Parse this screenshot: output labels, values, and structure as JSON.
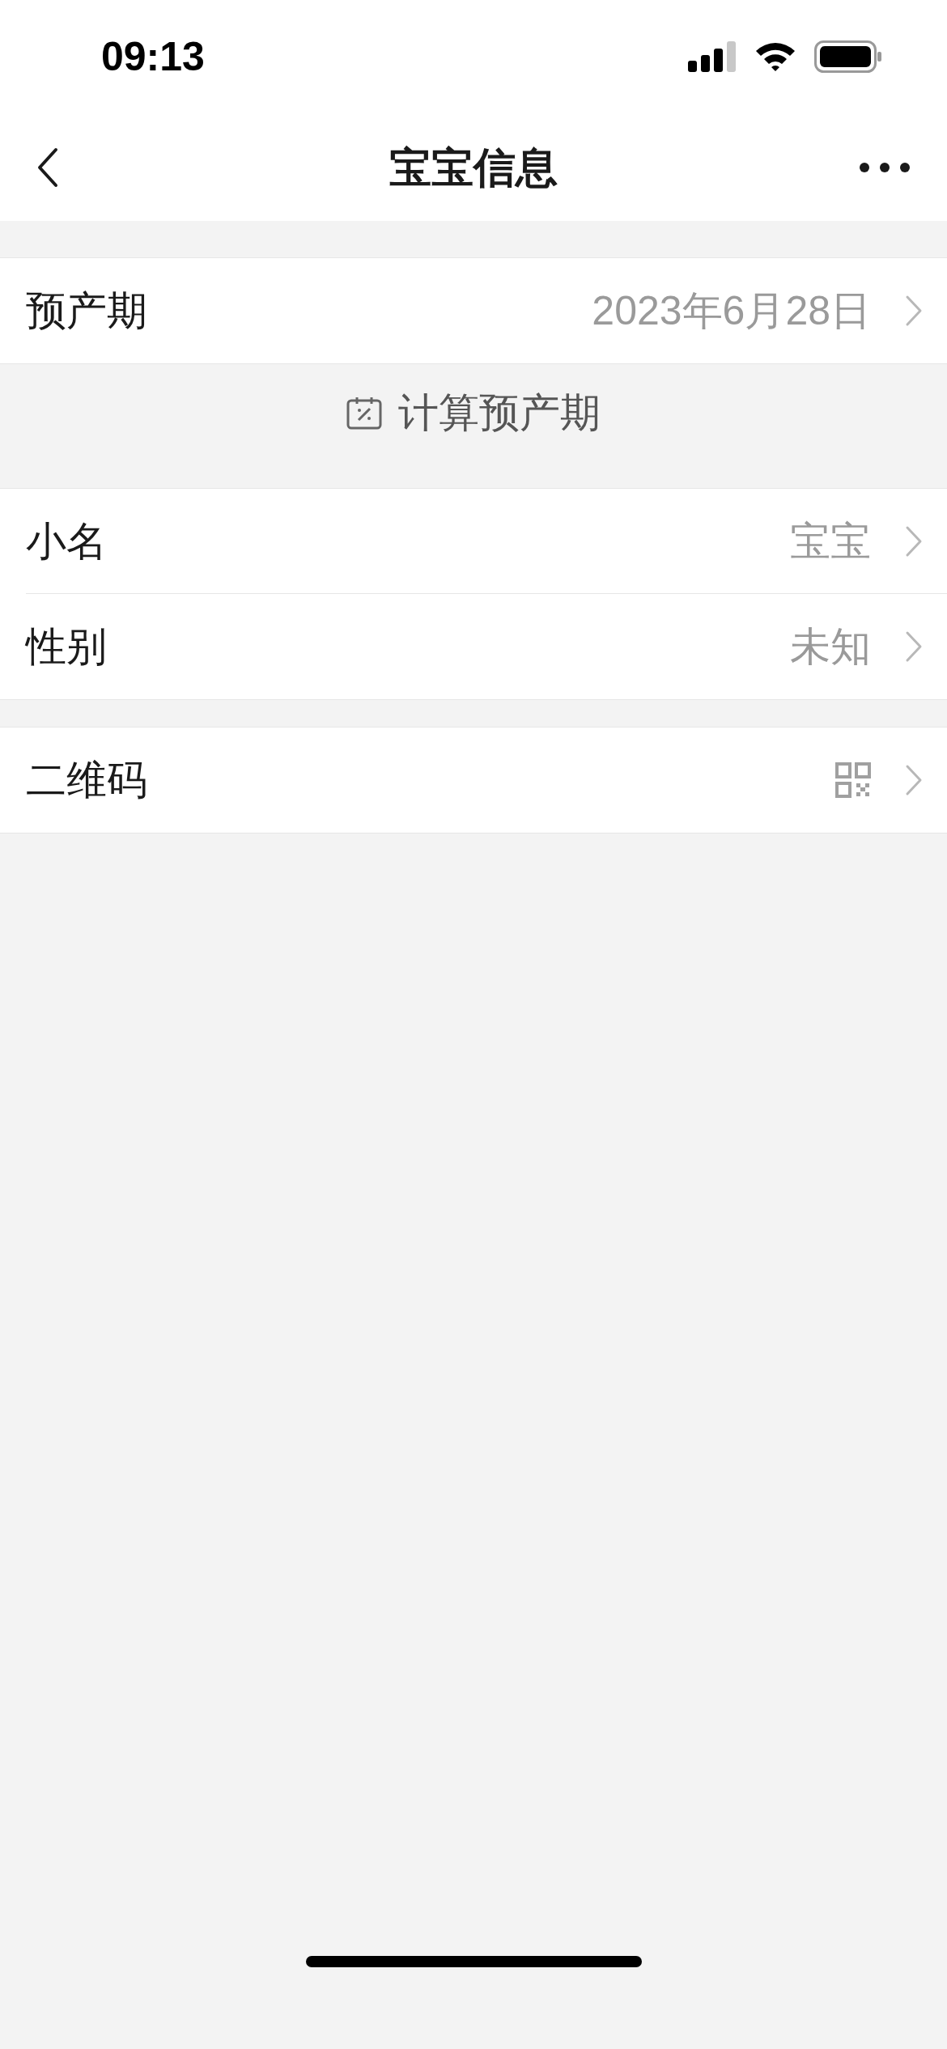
{
  "status_bar": {
    "time": "09:13"
  },
  "nav": {
    "title": "宝宝信息"
  },
  "groups": [
    {
      "rows": [
        {
          "label": "预产期",
          "kind": "text",
          "value": "2023年6月28日"
        }
      ],
      "action": {
        "label": "计算预产期"
      }
    },
    {
      "rows": [
        {
          "label": "小名",
          "kind": "text",
          "value": "宝宝"
        },
        {
          "label": "性别",
          "kind": "text",
          "value": "未知"
        }
      ]
    },
    {
      "rows": [
        {
          "label": "二维码",
          "kind": "qr"
        }
      ]
    }
  ]
}
